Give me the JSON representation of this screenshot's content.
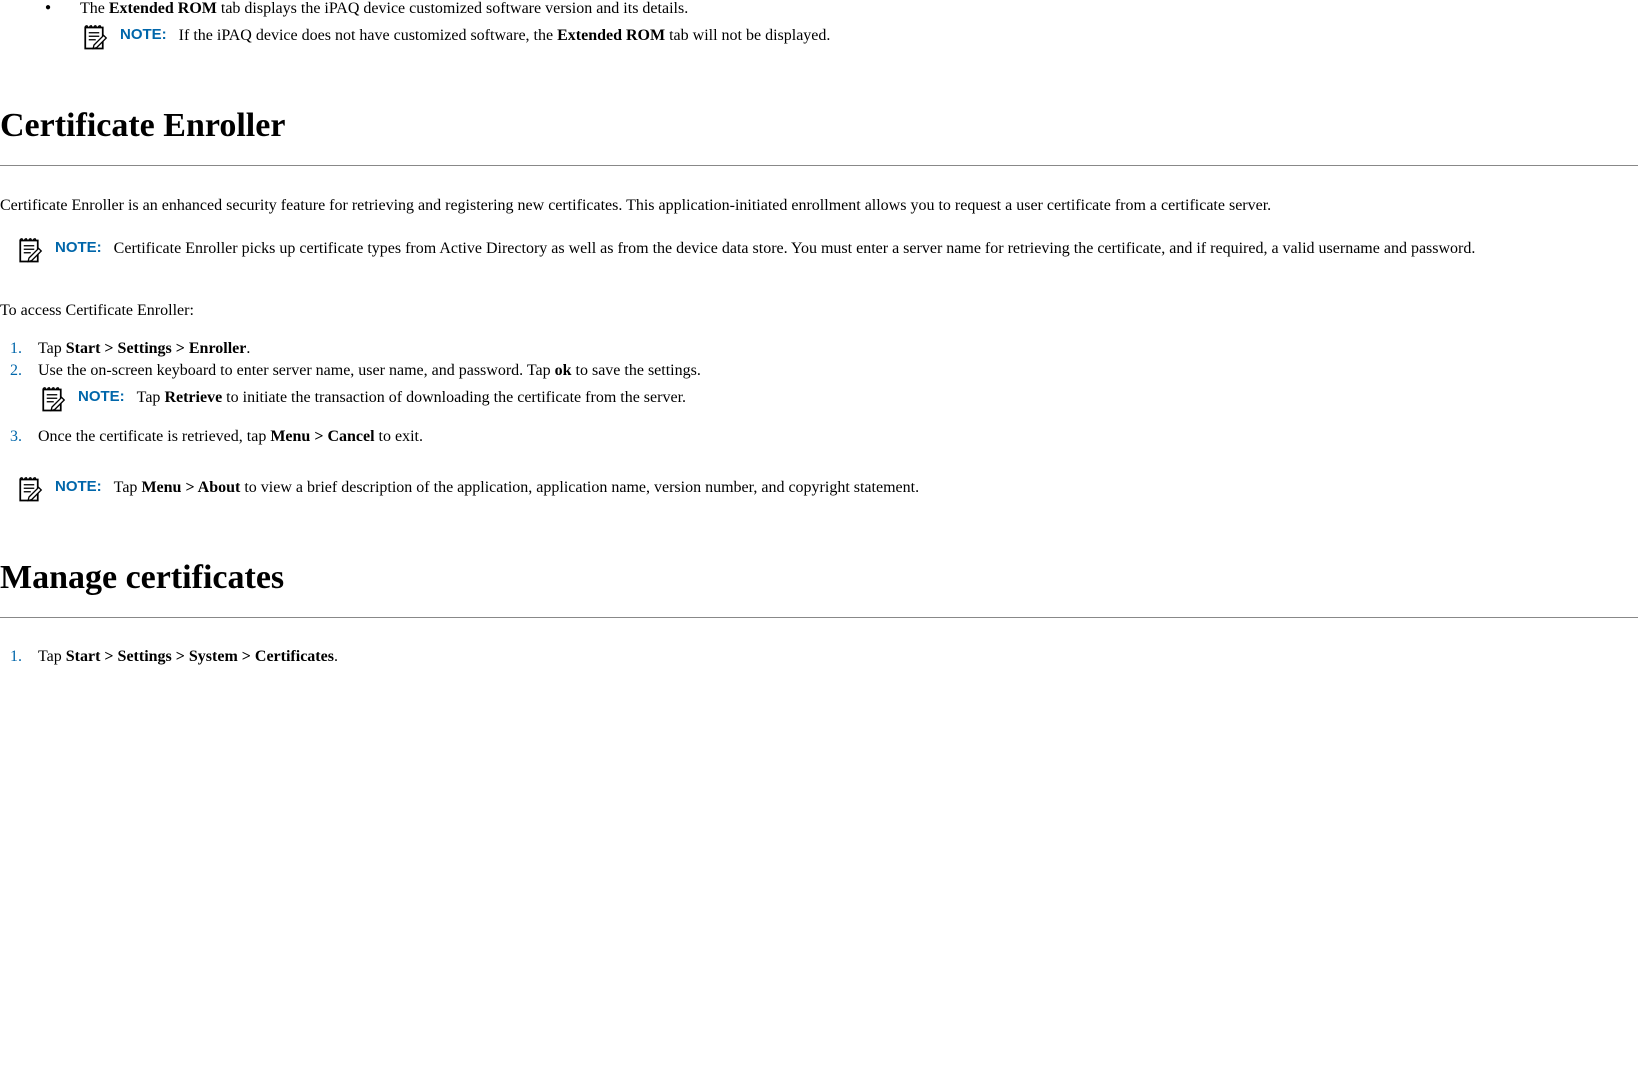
{
  "bullet1_pre": "The ",
  "bullet1_bold1": "Extended ROM",
  "bullet1_post": " tab displays the iPAQ device customized software version and its details.",
  "note_label": "NOTE:",
  "note1_pre": "If the iPAQ device does not have customized software, the ",
  "note1_bold": "Extended ROM",
  "note1_post": " tab will not be displayed.",
  "h1_cert": "Certificate Enroller",
  "cert_intro": "Certificate Enroller is an enhanced security feature for retrieving and registering new certificates. This application-initiated enrollment allows you to request a user certificate from a certificate server.",
  "note2_text": "Certificate Enroller picks up certificate types from Active Directory as well as from the device data store. You must enter a server name for retrieving the certificate, and if required, a valid username and password.",
  "access_intro": "To access Certificate Enroller:",
  "step1_pre": "Tap ",
  "step1_bold": "Start > Settings > Enroller",
  "step1_post": ".",
  "step2_pre": "Use the on-screen keyboard to enter server name, user name, and password. Tap ",
  "step2_bold": "ok",
  "step2_post": " to save the settings.",
  "note3_pre": "Tap ",
  "note3_bold": "Retrieve",
  "note3_post": " to initiate the transaction of downloading the certificate from the server.",
  "step3_pre": "Once the certificate is retrieved, tap ",
  "step3_bold": "Menu > Cancel",
  "step3_post": " to exit.",
  "note4_pre": "Tap ",
  "note4_bold": "Menu > About",
  "note4_post": " to view a brief description of the application, application name, version number, and copyright statement.",
  "h1_manage": "Manage certificates",
  "manage_step1_pre": "Tap ",
  "manage_step1_bold": "Start > Settings > System > Certificates",
  "manage_step1_post": ".",
  "num1": "1.",
  "num2": "2.",
  "num3": "3."
}
